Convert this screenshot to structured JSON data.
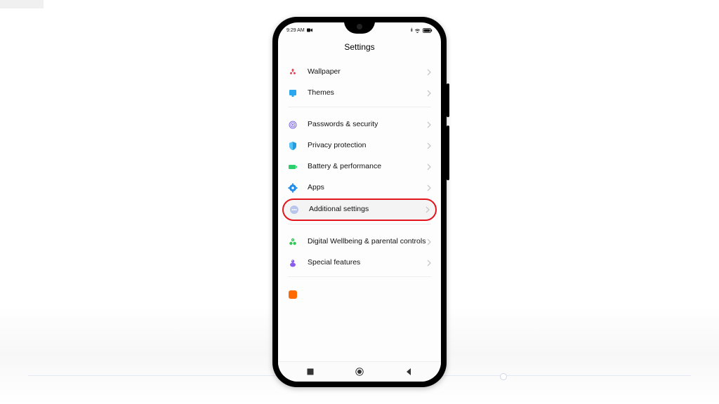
{
  "status": {
    "time": "9:29 AM",
    "camera": "▮",
    "signal": "᠁",
    "wifi": "wifi",
    "battery": "battery"
  },
  "page": {
    "title": "Settings"
  },
  "rows": {
    "wallpaper": "Wallpaper",
    "themes": "Themes",
    "passwords": "Passwords & security",
    "privacy": "Privacy protection",
    "battery": "Battery & performance",
    "apps": "Apps",
    "additional": "Additional settings",
    "wellbeing": "Digital Wellbeing & parental controls",
    "special": "Special features"
  }
}
